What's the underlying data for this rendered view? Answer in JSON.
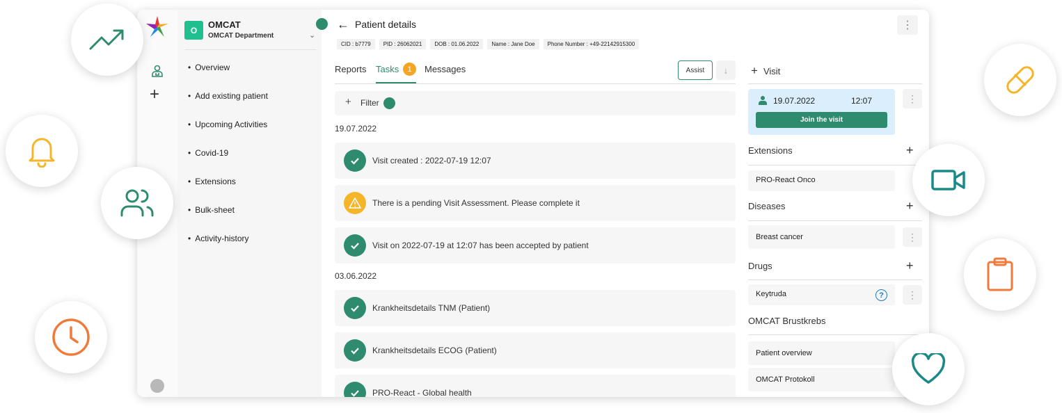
{
  "org": {
    "badge": "O",
    "name": "OMCAT",
    "department": "OMCAT Department"
  },
  "sidebar": {
    "items": [
      {
        "label": "Overview"
      },
      {
        "label": "Add existing patient"
      },
      {
        "label": "Upcoming Activities"
      },
      {
        "label": "Covid-19"
      },
      {
        "label": "Extensions"
      },
      {
        "label": "Bulk-sheet"
      },
      {
        "label": "Activity-history"
      }
    ]
  },
  "header": {
    "title": "Patient details",
    "chips": [
      "CID : b7779",
      "PID : 26062021",
      "DOB : 01.06.2022",
      "Name : Jane Doe",
      "Phone Number : +49-22142915300"
    ]
  },
  "tabs": {
    "reports": "Reports",
    "tasks": "Tasks",
    "tasks_count": "1",
    "messages": "Messages",
    "assist": "Assist"
  },
  "filter": {
    "label": "Filter"
  },
  "task_groups": [
    {
      "date": "19.07.2022",
      "tasks": [
        {
          "status": "ok",
          "text": "Visit created : 2022-07-19 12:07"
        },
        {
          "status": "warning",
          "text": "There is a pending Visit Assessment. Please complete it"
        },
        {
          "status": "ok",
          "text": "Visit on 2022-07-19 at 12:07 has been accepted by patient"
        }
      ]
    },
    {
      "date": "03.06.2022",
      "tasks": [
        {
          "status": "ok",
          "text": "Krankheitsdetails TNM (Patient)"
        },
        {
          "status": "ok",
          "text": "Krankheitsdetails ECOG (Patient)"
        },
        {
          "status": "ok",
          "text": "PRO-React - Global health"
        }
      ]
    }
  ],
  "right_panel": {
    "visit_label": "Visit",
    "visit": {
      "date": "19.07.2022",
      "time": "12:07",
      "join_label": "Join the visit"
    },
    "extensions": {
      "title": "Extensions",
      "items": [
        "PRO-React Onco"
      ]
    },
    "diseases": {
      "title": "Diseases",
      "items": [
        "Breast cancer"
      ]
    },
    "drugs": {
      "title": "Drugs",
      "items": [
        "Keytruda"
      ]
    },
    "program": {
      "title": "OMCAT Brustkrebs",
      "items": [
        "Patient overview",
        "OMCAT Protokoll"
      ]
    }
  },
  "colors": {
    "primary": "#2e8b6d",
    "warning": "#f5b52b",
    "visit_card": "#dbeefc",
    "org_badge": "#1fbf8f"
  },
  "decorations": [
    "trending-up-icon",
    "bell-icon",
    "users-icon",
    "clock-icon",
    "pill-icon",
    "video-icon",
    "clipboard-icon",
    "heart-icon"
  ]
}
